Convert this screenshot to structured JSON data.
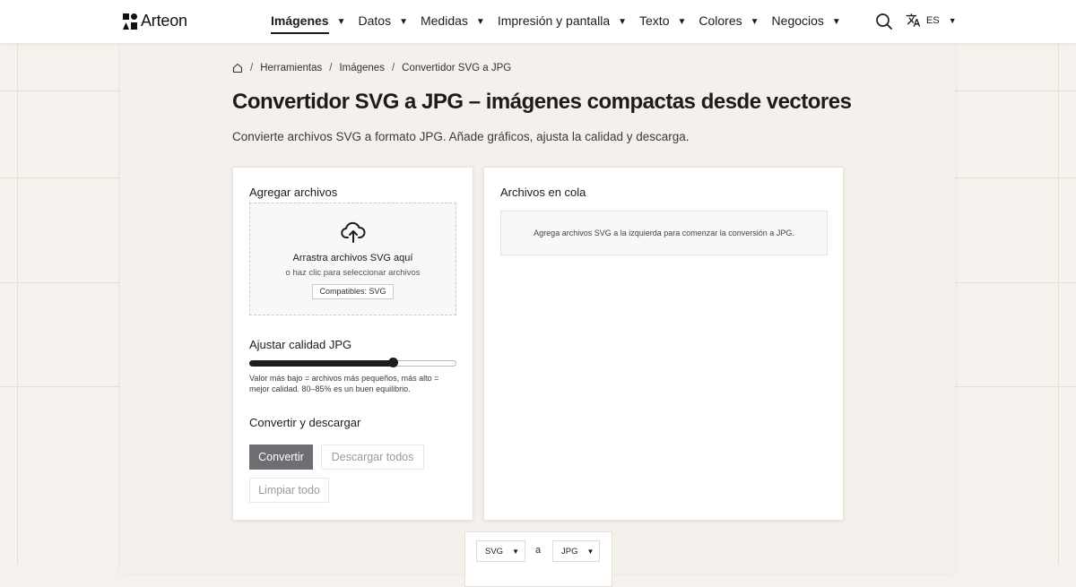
{
  "header": {
    "logo_text": "Arteon",
    "nav": [
      {
        "label": "Imágenes",
        "active": true
      },
      {
        "label": "Datos",
        "active": false
      },
      {
        "label": "Medidas",
        "active": false
      },
      {
        "label": "Impresión y pantalla",
        "active": false
      },
      {
        "label": "Texto",
        "active": false
      },
      {
        "label": "Colores",
        "active": false
      },
      {
        "label": "Negocios",
        "active": false
      }
    ],
    "language": "ES"
  },
  "breadcrumb": [
    "Herramientas",
    "Imágenes",
    "Convertidor SVG a JPG"
  ],
  "page": {
    "title": "Convertidor SVG a JPG – imágenes compactas desde vectores",
    "subtitle": "Convierte archivos SVG a formato JPG. Añade gráficos, ajusta la calidad y descarga."
  },
  "upload": {
    "title": "Agregar archivos",
    "drop_text": "Arrastra archivos SVG aquí",
    "click_text": "o haz clic para seleccionar archivos",
    "compatible": "Compatibles: SVG"
  },
  "quality": {
    "title": "Ajustar calidad JPG",
    "value_fraction": 0.7,
    "hint": "Valor más bajo = archivos más pequeños, más alto = mejor calidad. 80–85% es un buen equilibrio."
  },
  "actions": {
    "title": "Convertir y descargar",
    "convert": "Convertir",
    "download_all": "Descargar todos",
    "clear_all": "Limpiar todo"
  },
  "queue": {
    "title": "Archivos en cola",
    "empty_text": "Agrega archivos SVG a la izquierda para comenzar la conversión a JPG."
  },
  "format": {
    "from": "SVG",
    "separator": "a",
    "to": "JPG"
  }
}
